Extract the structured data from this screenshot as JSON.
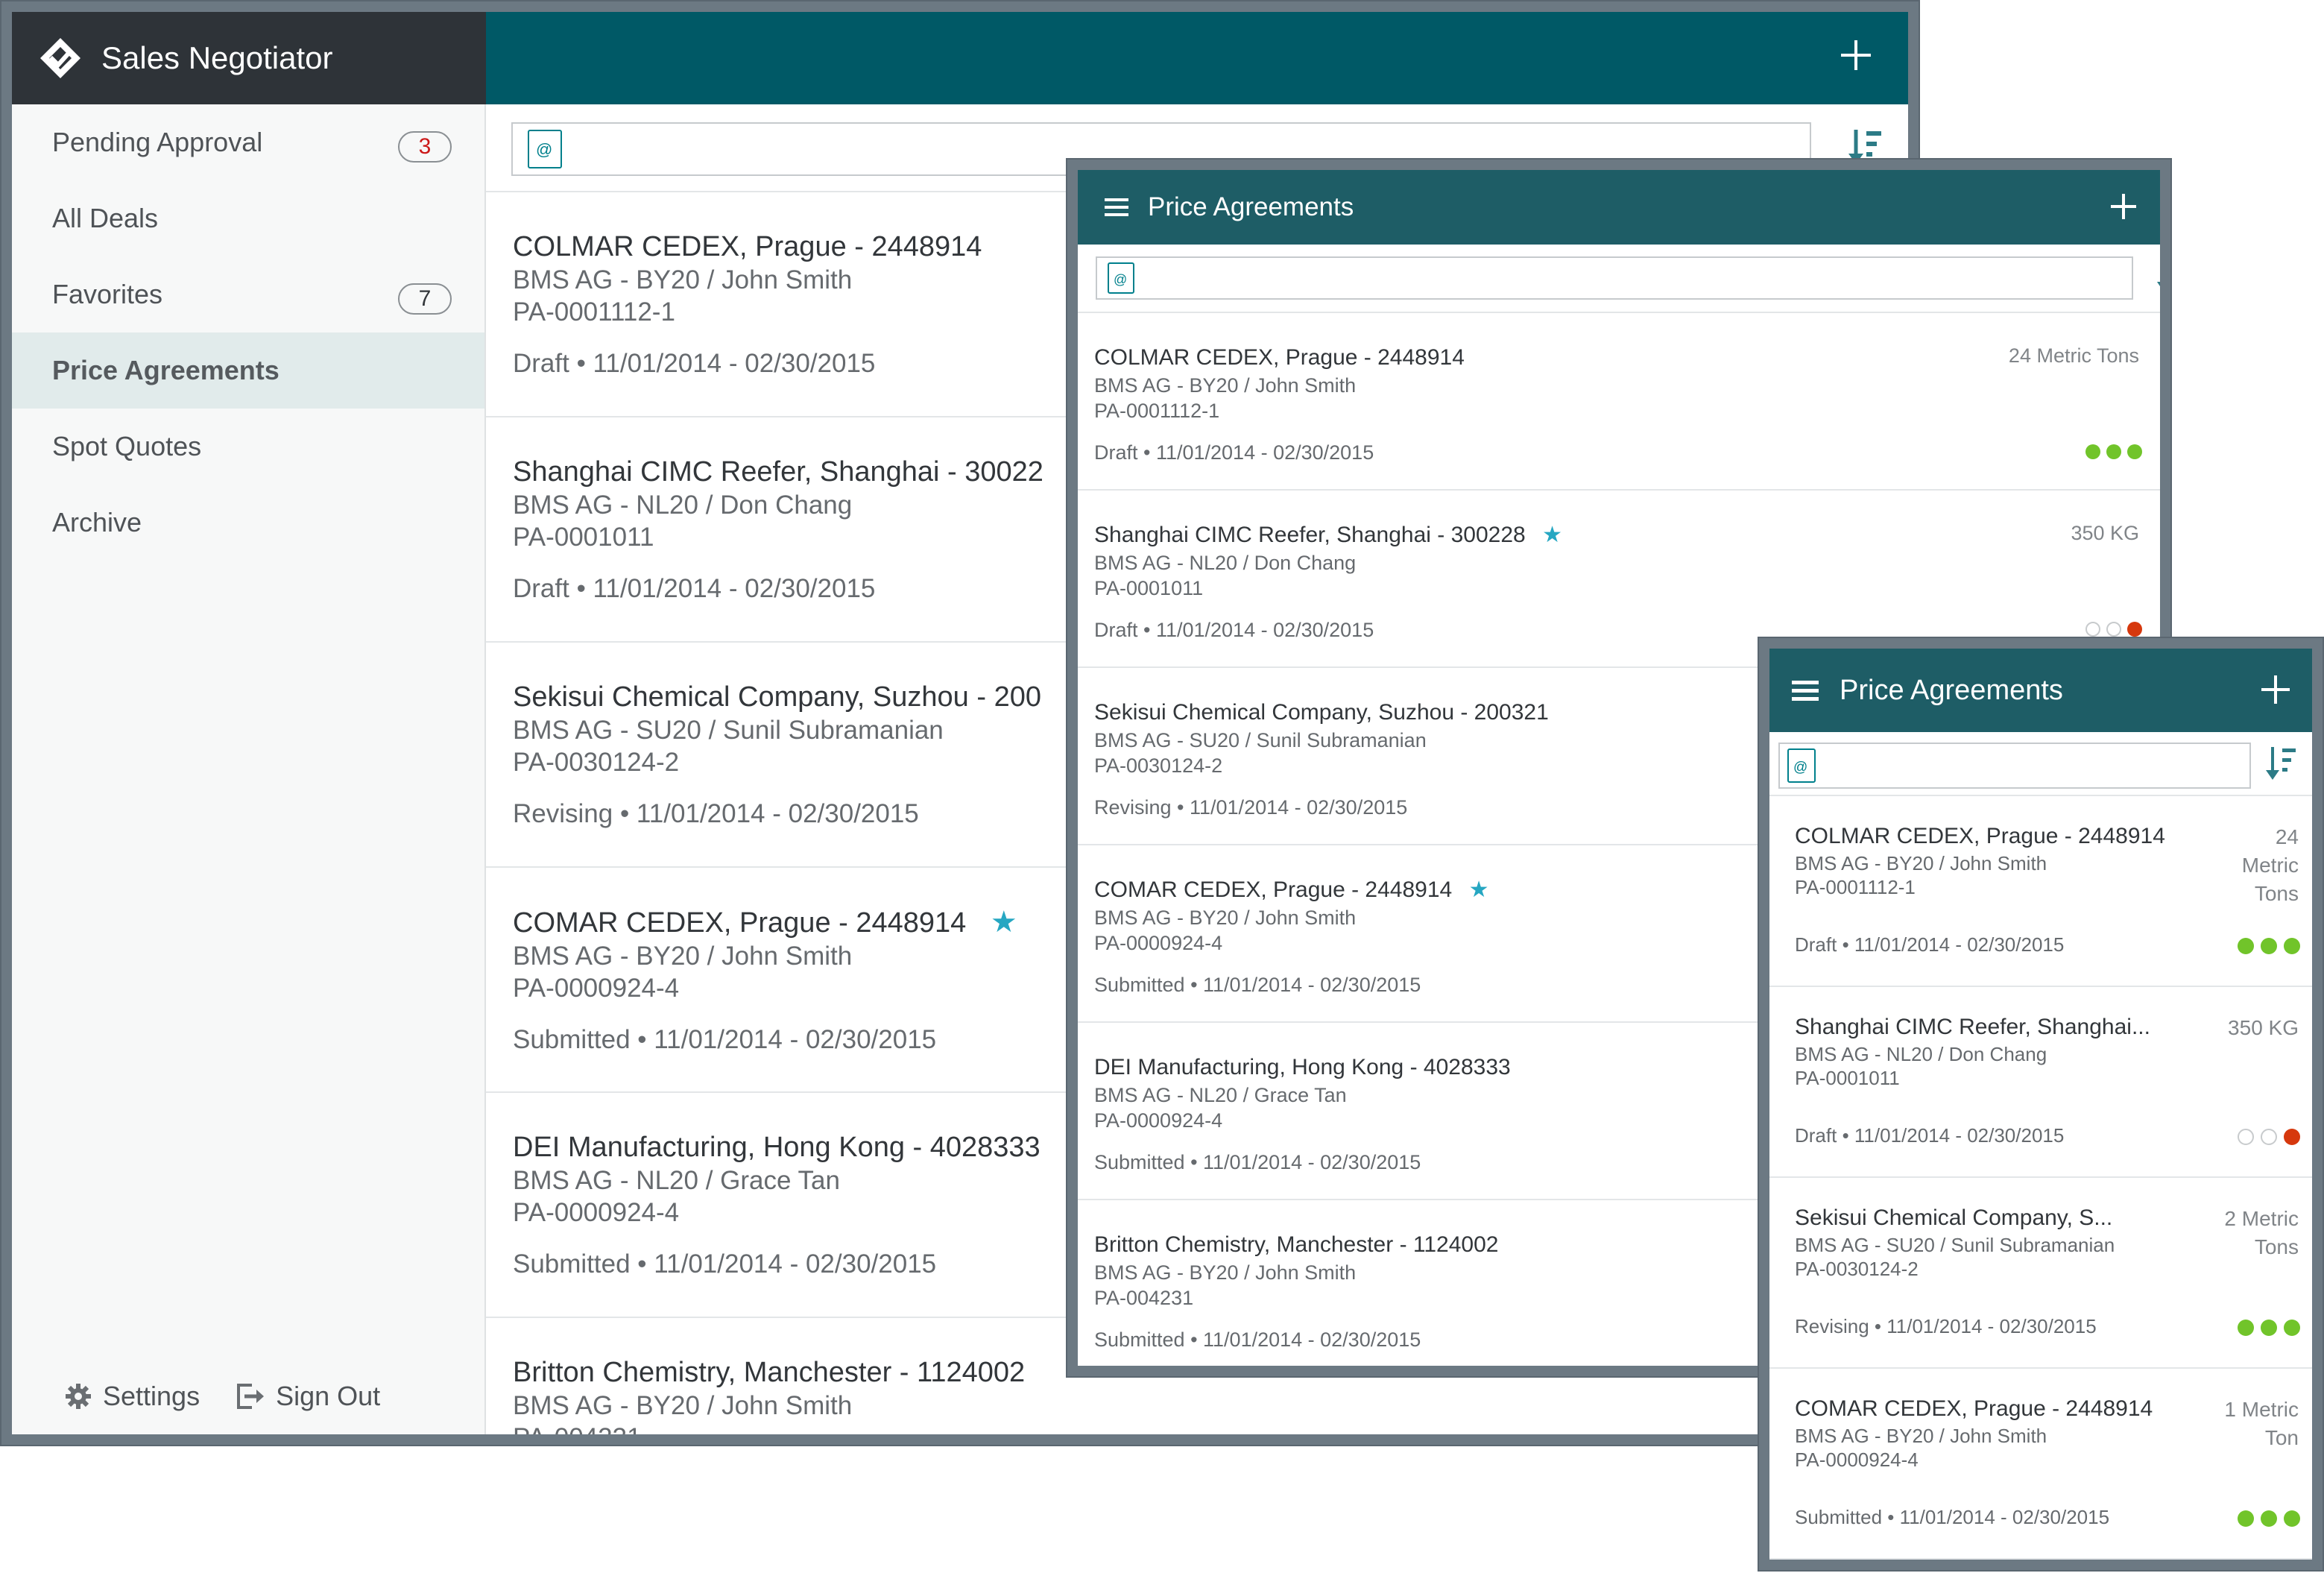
{
  "app": {
    "name": "Sales Negotiator",
    "search_placeholder": "",
    "sidebar": [
      {
        "label": "Pending Approval",
        "badge": "3"
      },
      {
        "label": "All Deals",
        "badge": ""
      },
      {
        "label": "Favorites",
        "badge": "7"
      },
      {
        "label": "Price Agreements",
        "badge": ""
      },
      {
        "label": "Spot Quotes",
        "badge": ""
      },
      {
        "label": "Archive",
        "badge": ""
      }
    ],
    "footer": {
      "settings": "Settings",
      "sign_out": "Sign Out"
    }
  },
  "items": [
    {
      "title": "COLMAR CEDEX, Prague - 2448914",
      "sub": "BMS AG - BY20 / John Smith",
      "pa": "PA-0001112-1",
      "status": "Draft • 11/01/2014 - 02/30/2015",
      "qty": "24 Metric Tons",
      "favorite": false,
      "dots": [
        "g",
        "g",
        "g"
      ]
    },
    {
      "title": "Shanghai CIMC Reefer, Shanghai - 300228",
      "title_short": "Shanghai CIMC Reefer, Shanghai...",
      "sub": "BMS AG - NL20 / Don Chang",
      "pa": "PA-0001011",
      "status": "Draft • 11/01/2014 - 02/30/2015",
      "qty": "350 KG",
      "favorite": true,
      "dots": [
        "e",
        "e",
        "r"
      ]
    },
    {
      "title": "Sekisui Chemical Company, Suzhou - 200321",
      "title_short": "Sekisui Chemical Company, S...",
      "sub": "BMS AG - SU20 / Sunil Subramanian",
      "pa": "PA-0030124-2",
      "status": "Revising • 11/01/2014 - 02/30/2015",
      "qty": "2 Metric Tons",
      "favorite": false,
      "dots": [
        "g",
        "g",
        "g"
      ]
    },
    {
      "title": "COMAR CEDEX, Prague - 2448914",
      "sub": "BMS AG - BY20 / John Smith",
      "pa": "PA-0000924-4",
      "status": "Submitted • 11/01/2014 - 02/30/2015",
      "qty": "1 Metric Ton",
      "favorite": true,
      "dots": [
        "g",
        "g",
        "g"
      ]
    },
    {
      "title": "DEI Manufacturing, Hong Kong - 4028333",
      "sub": "BMS AG - NL20 / Grace Tan",
      "pa": "PA-0000924-4",
      "status": "Submitted • 11/01/2014 - 02/30/2015",
      "qty": "",
      "favorite": false,
      "dots": []
    },
    {
      "title": "Britton Chemistry, Manchester - 1124002",
      "sub": "BMS AG - BY20 / John Smith",
      "pa": "PA-004231",
      "status": "Submitted • 11/01/2014 - 02/30/2015",
      "qty": "",
      "favorite": false,
      "dots": []
    }
  ],
  "dev1_titles_visible": [
    "COLMAR CEDEX, Prague - 2448914",
    "Shanghai CIMC Reefer, Shanghai - 30022",
    "Sekisui Chemical Company, Suzhou - 200",
    "COMAR CEDEX, Prague - 2448914",
    "DEI Manufacturing, Hong Kong - 4028333",
    "Britton Chemistry, Manchester - 1124002"
  ],
  "page_title": "Price Agreements",
  "dev3_qty": [
    "24 Metric Tons",
    "350 KG",
    "2 Metric Tons",
    "1 Metric Ton"
  ],
  "colors": {
    "teal_header": "#005966",
    "panel_header": "#1e5d66",
    "brand_bar": "#2e3338",
    "green": "#71c42a",
    "red": "#d6380d",
    "star": "#26a7c2"
  }
}
